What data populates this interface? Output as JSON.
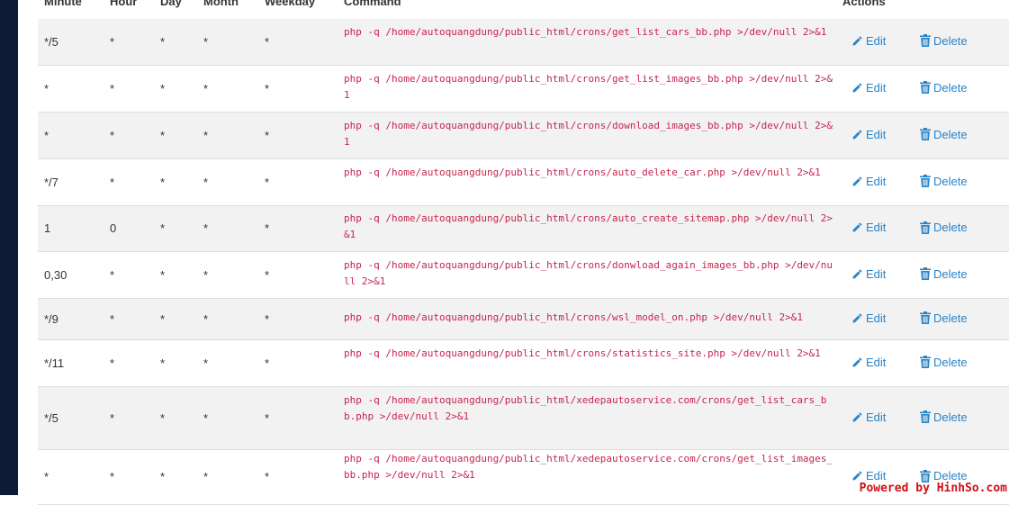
{
  "header": {
    "minute": "Minute",
    "hour": "Hour",
    "day": "Day",
    "month": "Month",
    "weekday": "Weekday",
    "command": "Command",
    "actions": "Actions"
  },
  "actions": {
    "edit": "Edit",
    "delete": "Delete"
  },
  "rows": [
    {
      "minute": "*/5",
      "hour": "*",
      "day": "*",
      "month": "*",
      "weekday": "*",
      "command": "php -q /home/autoquangdung/public_html/crons/get_list_cars_bb.php >/dev/null 2>&1"
    },
    {
      "minute": "*",
      "hour": "*",
      "day": "*",
      "month": "*",
      "weekday": "*",
      "command": "php -q /home/autoquangdung/public_html/crons/get_list_images_bb.php >/dev/null 2>&1"
    },
    {
      "minute": "*",
      "hour": "*",
      "day": "*",
      "month": "*",
      "weekday": "*",
      "command": "php -q /home/autoquangdung/public_html/crons/download_images_bb.php >/dev/null 2>&1"
    },
    {
      "minute": "*/7",
      "hour": "*",
      "day": "*",
      "month": "*",
      "weekday": "*",
      "command": "php -q /home/autoquangdung/public_html/crons/auto_delete_car.php >/dev/null 2>&1"
    },
    {
      "minute": "1",
      "hour": "0",
      "day": "*",
      "month": "*",
      "weekday": "*",
      "command": "php -q /home/autoquangdung/public_html/crons/auto_create_sitemap.php >/dev/null 2>&1"
    },
    {
      "minute": "0,30",
      "hour": "*",
      "day": "*",
      "month": "*",
      "weekday": "*",
      "command": "php -q /home/autoquangdung/public_html/crons/donwload_again_images_bb.php >/dev/null 2>&1"
    },
    {
      "minute": "*/9",
      "hour": "*",
      "day": "*",
      "month": "*",
      "weekday": "*",
      "command": "php -q /home/autoquangdung/public_html/crons/wsl_model_on.php >/dev/null 2>&1"
    },
    {
      "minute": "*/11",
      "hour": "*",
      "day": "*",
      "month": "*",
      "weekday": "*",
      "command": "php -q /home/autoquangdung/public_html/crons/statistics_site.php >/dev/null 2>&1"
    },
    {
      "minute": "*/5",
      "hour": "*",
      "day": "*",
      "month": "*",
      "weekday": "*",
      "command": "php -q /home/autoquangdung/public_html/xedepautoservice.com/crons/get_list_cars_bb.php >/dev/null 2>&1"
    },
    {
      "minute": "*",
      "hour": "*",
      "day": "*",
      "month": "*",
      "weekday": "*",
      "command": "php -q /home/autoquangdung/public_html/xedepautoservice.com/crons/get_list_images_bb.php >/dev/null 2>&1"
    }
  ],
  "watermark": "Powered by HinhSo.com",
  "colors": {
    "command_text": "#c7254e",
    "link": "#2a83c7",
    "row_stripe": "#f2f2f2",
    "sidebar": "#0d1b36"
  },
  "icons": {
    "edit": "pencil-icon",
    "delete": "trash-icon"
  }
}
